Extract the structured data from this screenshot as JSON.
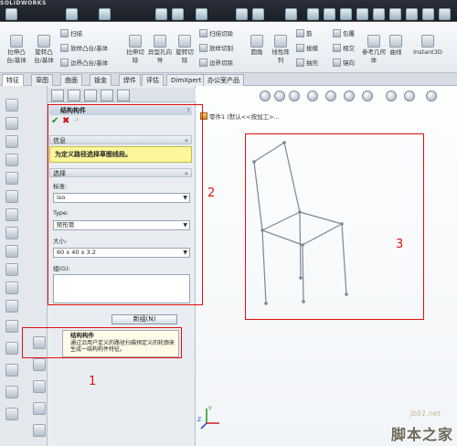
{
  "app": {
    "logo_text": "SOLIDWORKS"
  },
  "command_manager": {
    "big_buttons": [
      "拉伸凸台/基体",
      "旋转凸台/基体",
      "拉伸切除",
      "异型孔向导",
      "旋转切除",
      "圆角",
      "线性阵列",
      "参考几何体",
      "曲线",
      "Instant3D"
    ],
    "small_buttons": [
      "扫描",
      "放样凸台/基体",
      "边界凸台/基体",
      "扫描切除",
      "放样切割",
      "边界切除",
      "筋",
      "拔模",
      "抽壳",
      "包覆",
      "相交",
      "镜向"
    ]
  },
  "tabs": [
    "特征",
    "草图",
    "曲面",
    "钣金",
    "焊件",
    "评估",
    "DimXpert",
    "办公室产品"
  ],
  "property_manager": {
    "title": "结构构件",
    "help": "?",
    "ok_symbol": "✔",
    "cancel_symbol": "✖",
    "pin_symbol": "-¹",
    "info_header": "信息",
    "info_text": "为定义路径选择草图线段。",
    "selection_header": "选择",
    "standard_label": "标准:",
    "standard_value": "iso",
    "type_label": "Type:",
    "type_value": "矩形管",
    "size_label": "大小:",
    "size_value": "60 x 40 x 3.2",
    "group_label": "组(G):",
    "new_group_button": "新组(N)",
    "collapse_symbol": "»"
  },
  "tooltip": {
    "title": "结构构件",
    "body": "通过沿用户定义的路径扫描预定义的轮廓来生成一结构构件特征。"
  },
  "graphics": {
    "tree_text": "零件1 (默认<<按加工>...",
    "triad_labels": {
      "y": "Y",
      "z": "Z"
    }
  },
  "annotations": {
    "box1": "1",
    "box2": "2",
    "box3": "3"
  },
  "watermark": {
    "line1": "jb51.net",
    "line2": "脚本之家"
  }
}
